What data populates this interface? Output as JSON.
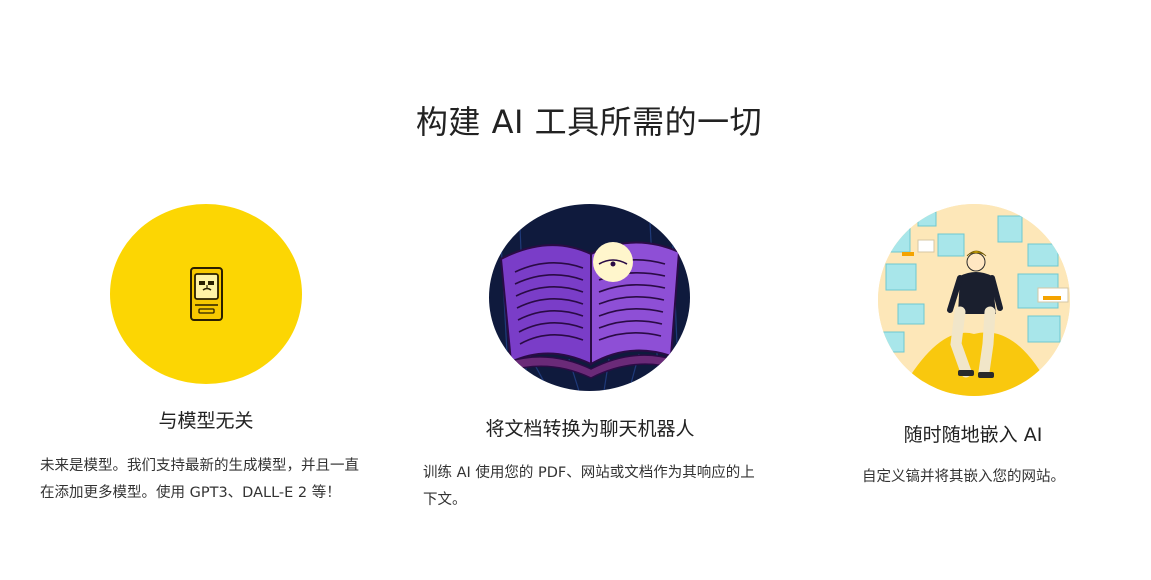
{
  "section": {
    "title": "构建 AI 工具所需的一切"
  },
  "features": [
    {
      "title": "与模型无关",
      "description": "未来是模型。我们支持最新的生成模型，并且一直在添加更多模型。使用 GPT3、DALL-E 2 等！",
      "icon": "retro-computer-icon",
      "accent": "#FCD603"
    },
    {
      "title": "将文档转换为聊天机器人",
      "description": "训练 AI 使用您的 PDF、网站或文档作为其响应的上下文。",
      "icon": "open-book-illustration",
      "accent": "#8E4FD6"
    },
    {
      "title": "随时随地嵌入 AI",
      "description": "自定义镐并将其嵌入您的网站。",
      "icon": "person-on-hill-illustration",
      "accent": "#F9C80E"
    }
  ]
}
